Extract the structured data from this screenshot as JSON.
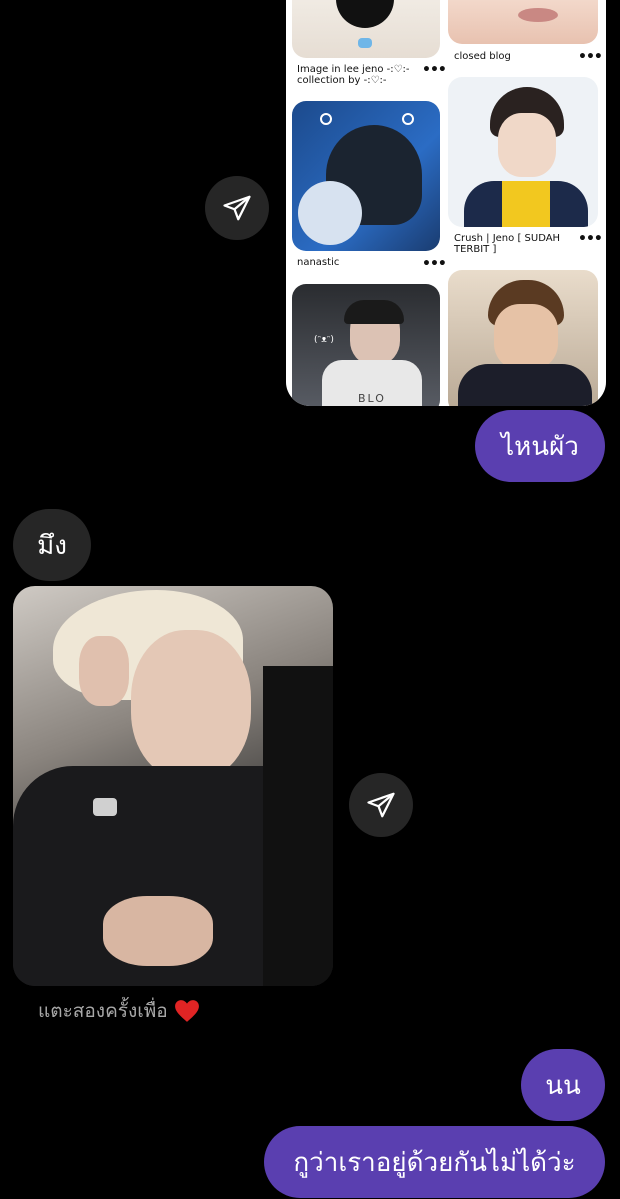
{
  "shared_post": {
    "captions": {
      "c1": "Image in lee jeno  -:♡:- collection by -:♡:-",
      "c2": "closed blog",
      "c3": "nanastic",
      "c4": "Crush | Jeno [ SUDAH TERBIT ]"
    },
    "more": "•••",
    "overlay_text": {
      "doodle": "(ᵔᴥᵔ)",
      "shirt": "BLO"
    }
  },
  "messages": {
    "m1": "ไหนผัว",
    "m2": "มึง",
    "m3_hint": "แตะสองครั้งเพื่อ",
    "m4": "นน",
    "m5": "กูว่าเราอยู่ด้วยกันไม่ได้ว่ะ"
  },
  "icons": {
    "share": "paper-plane-icon",
    "heart": "heart-icon"
  },
  "colors": {
    "background": "#000000",
    "outgoing_bubble": "#5a3fb0",
    "incoming_bubble": "#262626",
    "heart": "#e02424"
  }
}
